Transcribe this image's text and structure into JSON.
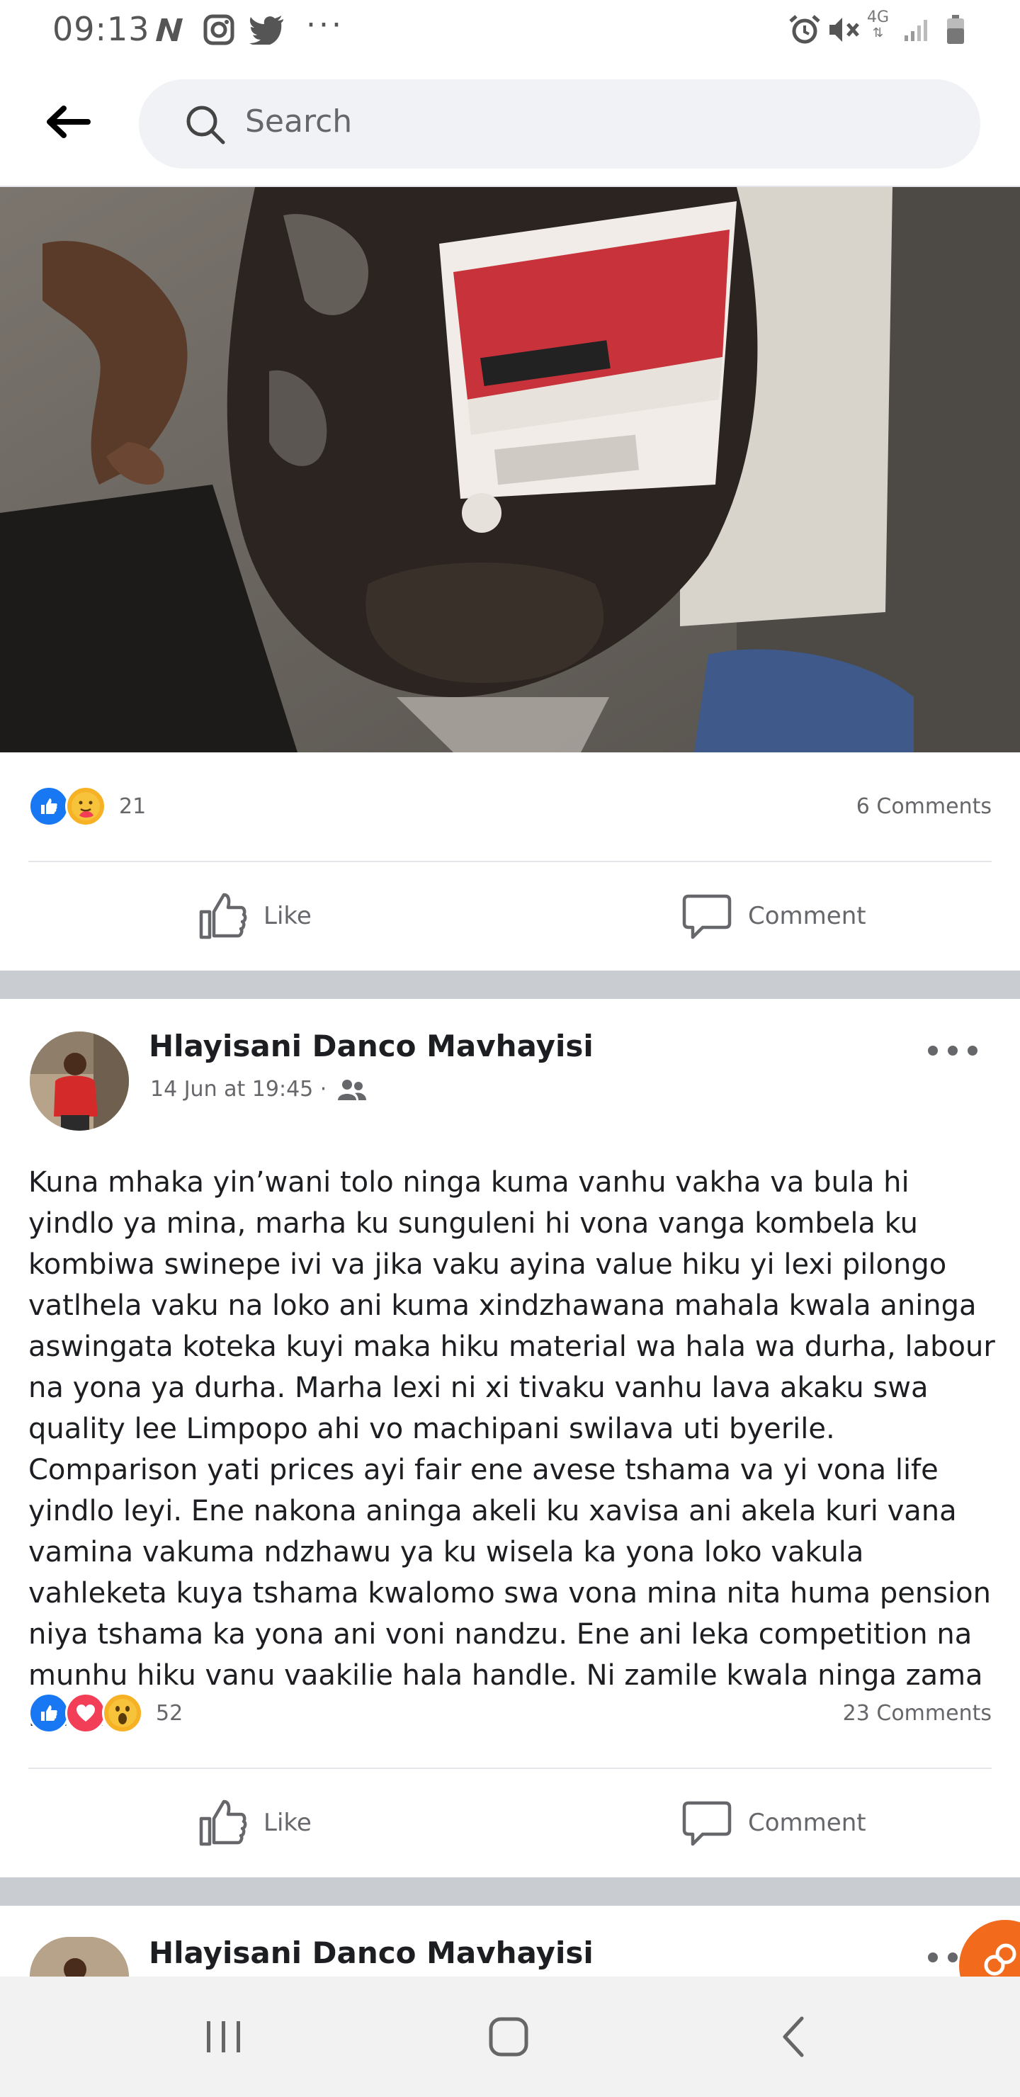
{
  "status_bar": {
    "time": "09:13",
    "network": "4G",
    "icons": [
      "n-app-icon",
      "instagram-icon",
      "twitter-icon",
      "more-dots-icon",
      "alarm-icon",
      "mute-icon",
      "signal-icon",
      "battery-icon"
    ],
    "dots": "···"
  },
  "search": {
    "placeholder": "Search"
  },
  "post1": {
    "reactions": [
      "like",
      "care"
    ],
    "reaction_count": "21",
    "comments": "6 Comments",
    "like_label": "Like",
    "comment_label": "Comment"
  },
  "post2": {
    "author": "Hlayisani Danco Mavhayisi",
    "timestamp": "14 Jun at 19:45 ·",
    "audience_icon": "friends-icon",
    "text": "Kuna mhaka yin’wani tolo ninga kuma vanhu vakha va bula hi yindlo ya mina, marha ku sunguleni hi vona vanga kombela ku kombiwa swinepe ivi va jika vaku ayina value hiku yi lexi pilongo vatlhela vaku na loko ani kuma xindzhawana mahala kwala aninga aswingata koteka kuyi maka hiku material wa hala wa durha, labour na yona ya durha. Marha lexi ni xi tivaku vanhu lava akaku swa quality lee Limpopo ahi vo machipani swilava uti byerile. Comparison yati prices ayi fair ene avese tshama va yi vona life yindlo leyi. Ene nakona aninga akeli ku xavisa ani akela kuri vana vamina vakuma ndzhawu ya ku wisela ka yona loko vakula vahleketa kuya tshama kwalomo swa vona mina nita huma pension niya tshama ka yona ani voni nandzu. Ene ani leka competition na munhu hiku vanu vaakilie hala handle. Ni zamile kwala ninga zama kona.",
    "reactions": [
      "like",
      "love",
      "wow"
    ],
    "reaction_count": "52",
    "comments": "23 Comments",
    "like_label": "Like",
    "comment_label": "Comment"
  },
  "post3": {
    "author": "Hlayisani Danco Mavhayisi"
  },
  "colors": {
    "facebook_blue": "#1877f2",
    "love_red": "#f33e58",
    "wow_yellow": "#f7b125",
    "muted_text": "#65676b",
    "separator": "#c9ccd1"
  }
}
